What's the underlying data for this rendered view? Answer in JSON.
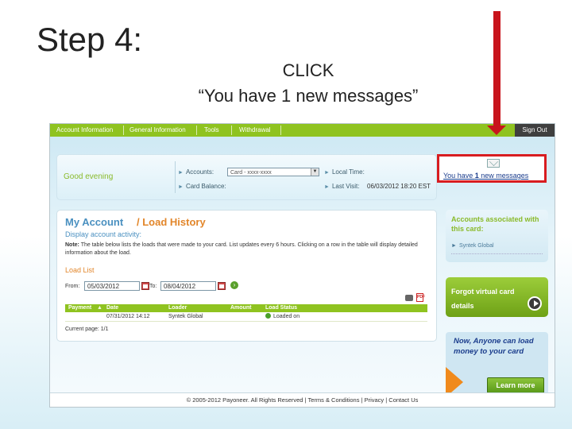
{
  "slide": {
    "title": "Step 4:",
    "instruction_line1": "CLICK",
    "instruction_line2": "“You have 1 new messages”"
  },
  "colors": {
    "arrow": "#c8141c",
    "highlight_box": "#d81c20",
    "nav_green": "#8fc320",
    "accent_orange": "#e2862a",
    "link_blue": "#1a3c8c"
  },
  "nav": {
    "items": [
      "Account Information",
      "General Information",
      "Tools",
      "Withdrawal"
    ],
    "sign_out": "Sign Out"
  },
  "header": {
    "greeting": "Good evening",
    "accounts_label": "Accounts:",
    "accounts_value": "Card - xxxx-xxxx",
    "card_balance_label": "Card Balance:",
    "local_time_label": "Local Time:",
    "last_visit_label": "Last Visit:",
    "last_visit_value": "06/03/2012 18:20 EST",
    "messages_prefix": "You have ",
    "messages_count": "1",
    "messages_suffix": " new messages"
  },
  "main": {
    "title_part1": "My Account",
    "title_sep": " / ",
    "title_part2": "Load History",
    "subtitle": "Display account activity:",
    "note_label": "Note:",
    "note_text": " The table below lists the loads that were made to your card. List updates every 6 hours. Clicking on a row in the table will display detailed information about the load.",
    "load_list_label": "Load List",
    "from_label": "From:",
    "from_value": "05/03/2012",
    "to_label": "To:",
    "to_value": "08/04/2012",
    "pdf_text": "PDF",
    "table": {
      "headers": [
        "Payment",
        "Date",
        "Loader",
        "Amount",
        "Load Status"
      ],
      "rows": [
        {
          "payment": "",
          "date": "07/31/2012 14:12",
          "loader": "Syntek Global",
          "amount": "",
          "status": "Loaded on"
        }
      ]
    },
    "current_page": "Current page: 1/1"
  },
  "sidebar": {
    "assoc_title": "Accounts associated with this card:",
    "assoc_item": "Syntek Global",
    "virtual_card": "Forgot virtual card details",
    "promo_text": "Now, Anyone can load money to your card",
    "learn_more": "Learn more"
  },
  "footer": {
    "text": "© 2005-2012 Payoneer. All Rights Reserved | Terms & Conditions | Privacy | Contact Us"
  }
}
